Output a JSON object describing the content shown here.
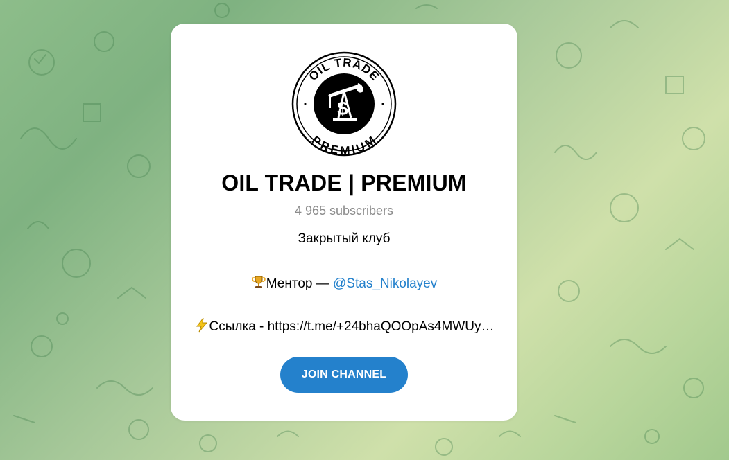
{
  "channel": {
    "avatar_text_top": "OIL TRADE",
    "avatar_text_bottom": "PREMIUM",
    "avatar_icon": "oil-pump-dollar-icon",
    "title": "OIL TRADE | PREMIUM",
    "subscribers": "4 965 subscribers"
  },
  "description": {
    "line1": "Закрытый клуб",
    "line2_prefix": "Ментор — ",
    "line2_emoji": "trophy-icon",
    "line2_mention": "@Stas_Nikolayev",
    "line3_emoji": "lightning-icon",
    "line3_text": "Ссылка - https://t.me/+24bhaQOOpAs4MWUy…"
  },
  "actions": {
    "join_label": "JOIN CHANNEL"
  },
  "colors": {
    "accent": "#2481cc",
    "muted": "#8c8c8c",
    "card": "#ffffff"
  }
}
